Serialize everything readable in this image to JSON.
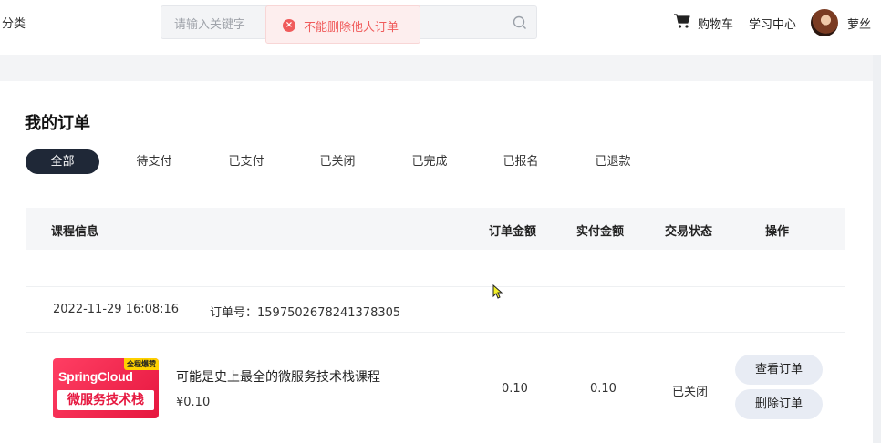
{
  "header": {
    "category_label": "分类",
    "search": {
      "placeholder": "请输入关键字"
    },
    "toast": {
      "message": "不能删除他人订单",
      "icon": "error-circle-icon",
      "color": "#f05b5b"
    },
    "cart_label": "购物车",
    "learning_center_label": "学习中心",
    "user_name": "萝丝"
  },
  "page": {
    "title": "我的订单",
    "tabs": [
      {
        "label": "全部",
        "active": true
      },
      {
        "label": "待支付",
        "active": false
      },
      {
        "label": "已支付",
        "active": false
      },
      {
        "label": "已关闭",
        "active": false
      },
      {
        "label": "已完成",
        "active": false
      },
      {
        "label": "已报名",
        "active": false
      },
      {
        "label": "已退款",
        "active": false
      }
    ],
    "table_headers": {
      "course_info": "课程信息",
      "order_amount": "订单金额",
      "paid_amount": "实付金额",
      "trade_status": "交易状态",
      "actions": "操作"
    }
  },
  "orders": [
    {
      "created_at": "2022-11-29 16:08:16",
      "order_no_label": "订单号：1597502678241378305",
      "thumbnail": {
        "badge": "全程爆赞",
        "line1": "SpringCloud",
        "line2": "微服务技术栈"
      },
      "course_name": "可能是史上最全的微服务技术栈课程",
      "price": "¥0.10",
      "order_amount": "0.10",
      "paid_amount": "0.10",
      "status": "已关闭",
      "view_button": "查看订单",
      "delete_button": "删除订单"
    }
  ],
  "colors": {
    "active_tab_bg": "#1f2837",
    "button_bg": "#e8ecf4",
    "error": "#f05b5b",
    "thumbnail_red": "#e6173f"
  }
}
